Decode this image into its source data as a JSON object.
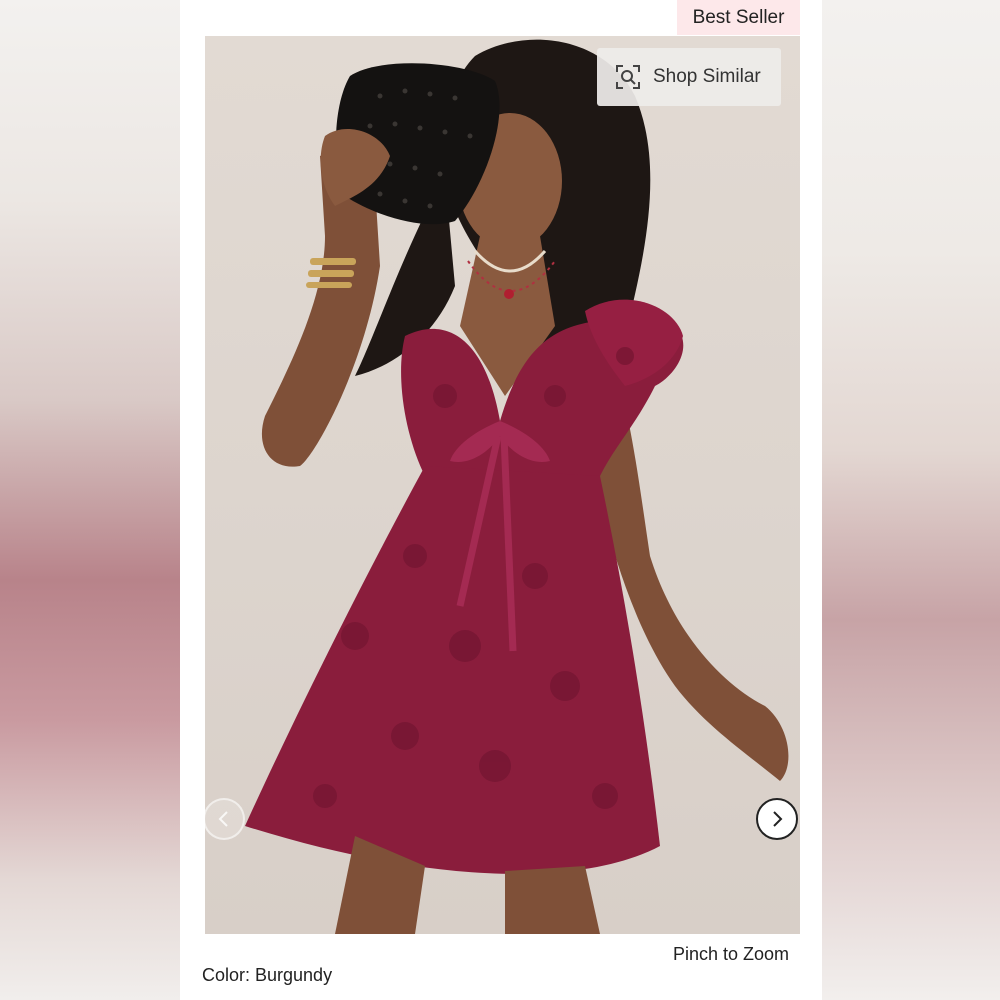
{
  "badge": {
    "text": "Best Seller"
  },
  "product_image": {
    "alt": "Model wearing a burgundy floral jacquard babydoll mini dress with ribbon tie, holding a black beaded clutch"
  },
  "shop_similar": {
    "label": "Shop Similar",
    "icon": "visual-search-icon"
  },
  "carousel": {
    "prev_icon": "chevron-left-icon",
    "next_icon": "chevron-right-icon"
  },
  "hint": {
    "text": "Pinch to Zoom"
  },
  "color": {
    "label": "Color: Burgundy"
  },
  "colors": {
    "badge_bg": "#fde8ea",
    "dress": "#8a1d3c",
    "background": "#e2dad3"
  }
}
